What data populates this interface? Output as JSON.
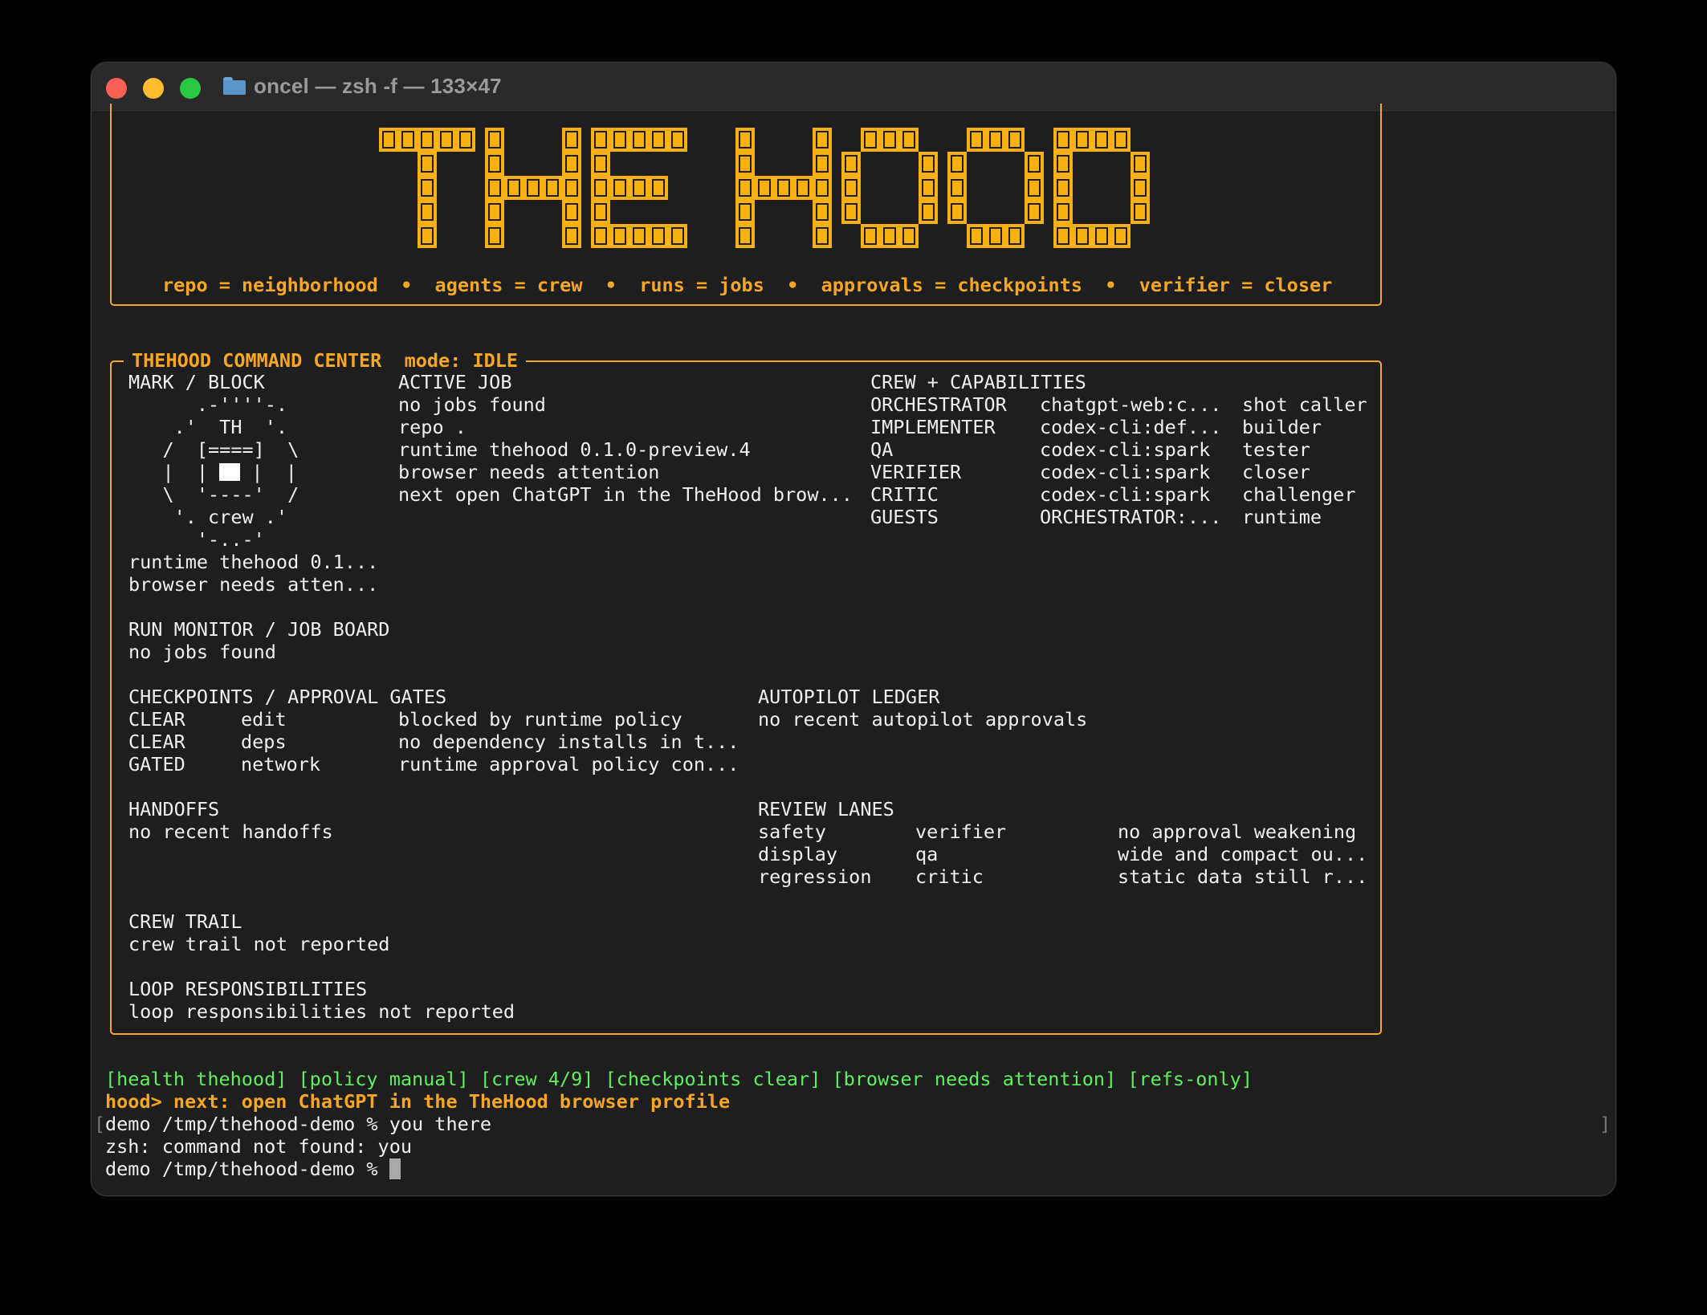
{
  "window": {
    "title": "oncel — zsh -f — 133×47"
  },
  "banner": {
    "logo_text": "THE HOOD",
    "tagline": "repo = neighborhood  •  agents = crew  •  runs = jobs  •  approvals = checkpoints  •  verifier = closer"
  },
  "command_center": {
    "title": "THEHOOD COMMAND CENTER",
    "mode": "mode: IDLE",
    "mark": {
      "heading": "MARK / BLOCK",
      "art": [
        "      .-''''-.",
        "    .'  TH  '.",
        "   /  [====]  \\",
        "   |  |",
        "|  |",
        "   \\  '----'  /",
        "    '. crew .'",
        "      '-..-'"
      ],
      "status1": "runtime thehood 0.1...",
      "status2": "browser needs atten..."
    },
    "active_job": {
      "heading": "ACTIVE JOB",
      "lines": [
        "no jobs found",
        "repo .",
        "runtime thehood 0.1.0-preview.4",
        "browser needs attention",
        "next open ChatGPT in the TheHood brow..."
      ]
    },
    "crew": {
      "heading": "CREW + CAPABILITIES",
      "rows": [
        {
          "role": "ORCHESTRATOR",
          "cap": "chatgpt-web:c...",
          "alias": "shot caller"
        },
        {
          "role": "IMPLEMENTER",
          "cap": "codex-cli:def...",
          "alias": "builder"
        },
        {
          "role": "QA",
          "cap": "codex-cli:spark",
          "alias": "tester"
        },
        {
          "role": "VERIFIER",
          "cap": "codex-cli:spark",
          "alias": "closer"
        },
        {
          "role": "CRITIC",
          "cap": "codex-cli:spark",
          "alias": "challenger"
        },
        {
          "role": "GUESTS",
          "cap": "ORCHESTRATOR:...",
          "alias": "runtime"
        }
      ]
    },
    "run_monitor": {
      "heading": "RUN MONITOR / JOB BOARD",
      "line": "no jobs found"
    },
    "checkpoints": {
      "heading": "CHECKPOINTS / APPROVAL GATES",
      "rows": [
        {
          "state": "CLEAR",
          "gate": "edit",
          "note": "blocked by runtime policy"
        },
        {
          "state": "CLEAR",
          "gate": "deps",
          "note": "no dependency installs in t..."
        },
        {
          "state": "GATED",
          "gate": "network",
          "note": "runtime approval policy con..."
        }
      ]
    },
    "autopilot": {
      "heading": "AUTOPILOT LEDGER",
      "line": "no recent autopilot approvals"
    },
    "handoffs": {
      "heading": "HANDOFFS",
      "line": "no recent handoffs"
    },
    "review_lanes": {
      "heading": "REVIEW LANES",
      "rows": [
        {
          "lane": "safety",
          "owner": "verifier",
          "note": "no approval weakening"
        },
        {
          "lane": "display",
          "owner": "qa",
          "note": "wide and compact ou..."
        },
        {
          "lane": "regression",
          "owner": "critic",
          "note": "static data still r..."
        }
      ]
    },
    "crew_trail": {
      "heading": "CREW TRAIL",
      "line": "crew trail not reported"
    },
    "loop": {
      "heading": "LOOP RESPONSIBILITIES",
      "line": "loop responsibilities not reported"
    }
  },
  "terminal": {
    "status_line": "[health thehood] [policy manual] [crew 4/9] [checkpoints clear] [browser needs attention] [refs-only]",
    "hood_prompt": "hood> next: open ChatGPT in the TheHood browser profile",
    "bracket_left": "[",
    "bracket_right": "]",
    "cmd1": "demo /tmp/thehood-demo % you there",
    "error": "zsh: command not found: you",
    "prompt": "demo /tmp/thehood-demo % "
  },
  "colors": {
    "accent": "#f5a623",
    "status_green": "#5ef05e",
    "text": "#f0f0f0",
    "background": "#1e1e1e"
  }
}
